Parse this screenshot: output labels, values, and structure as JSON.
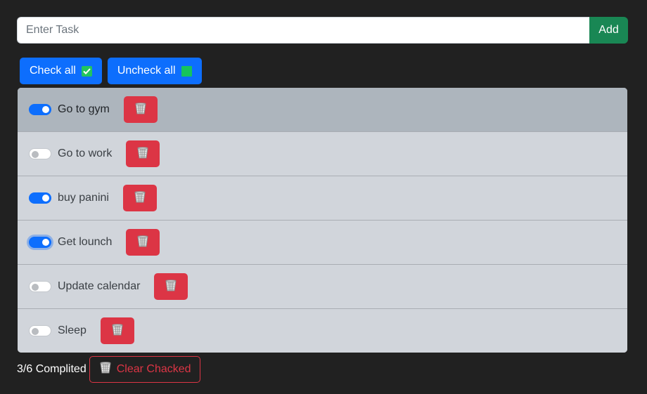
{
  "input": {
    "placeholder": "Enter Task",
    "value": ""
  },
  "add_button": {
    "label": "Add"
  },
  "bulk_actions": {
    "check_all": {
      "label": "Check all",
      "icon": "checkmark-box-icon"
    },
    "uncheck_all": {
      "label": "Uncheck all",
      "icon": "green-square-icon"
    }
  },
  "tasks": [
    {
      "label": "Go to gym",
      "checked": true,
      "highlighted": true
    },
    {
      "label": "Go to work",
      "checked": false
    },
    {
      "label": "buy panini",
      "checked": true
    },
    {
      "label": "Get lounch",
      "checked": true,
      "focused": true
    },
    {
      "label": "Update calendar",
      "checked": false
    },
    {
      "label": "Sleep",
      "checked": false
    }
  ],
  "footer": {
    "count_text": "3/6 Complited",
    "clear_label": "Clear Chacked",
    "clear_icon": "wastebasket-icon"
  },
  "colors": {
    "background": "#212121",
    "primary": "#0d6efd",
    "success": "#198754",
    "danger": "#dc3545",
    "list_bg": "#d1d5db",
    "active_bg": "#adb5bd"
  }
}
